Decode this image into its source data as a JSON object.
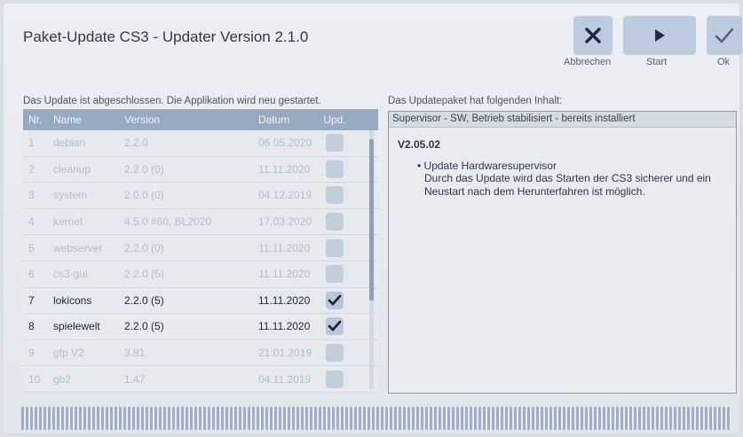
{
  "window": {
    "title": "Paket-Update CS3 - Updater Version 2.1.0"
  },
  "toolbar": {
    "cancel_label": "Abbrechen",
    "start_label": "Start",
    "ok_label": "Ok"
  },
  "status_text": "Das Update ist abgeschlossen. Die Applikation wird neu gestartet.",
  "panel_caption": "Das Updatepaket hat folgenden Inhalt:",
  "table": {
    "headers": {
      "nr": "Nr.",
      "name": "Name",
      "version": "Version",
      "date": "Datum",
      "upd": "Upd."
    },
    "rows": [
      {
        "nr": "1",
        "name": "debian",
        "version": "2.2.0",
        "date": "06.05.2020",
        "checked": false,
        "active": false
      },
      {
        "nr": "2",
        "name": "cleanup",
        "version": "2.2.0 (0)",
        "date": "11.11.2020",
        "checked": false,
        "active": false
      },
      {
        "nr": "3",
        "name": "system",
        "version": "2.0.0 (0)",
        "date": "04.12.2019",
        "checked": false,
        "active": false
      },
      {
        "nr": "4",
        "name": "kernel",
        "version": "4.5.0 #60, BL2020",
        "date": "17.03.2020",
        "checked": false,
        "active": false
      },
      {
        "nr": "5",
        "name": "webserver",
        "version": "2.2.0 (0)",
        "date": "11.11.2020",
        "checked": false,
        "active": false
      },
      {
        "nr": "6",
        "name": "cs3-gui",
        "version": "2.2.0 (5)",
        "date": "11.11.2020",
        "checked": false,
        "active": false
      },
      {
        "nr": "7",
        "name": "lokicons",
        "version": "2.2.0 (5)",
        "date": "11.11.2020",
        "checked": true,
        "active": true
      },
      {
        "nr": "8",
        "name": "spielewelt",
        "version": "2.2.0 (5)",
        "date": "11.11.2020",
        "checked": true,
        "active": true
      },
      {
        "nr": "9",
        "name": "gfp V2",
        "version": "3.81",
        "date": "21.01.2019",
        "checked": false,
        "active": false
      },
      {
        "nr": "10",
        "name": "gb2",
        "version": "1.47",
        "date": "04.11.2019",
        "checked": false,
        "active": false
      }
    ]
  },
  "content_panel": {
    "header": "Supervisor - SW, Betrieb stabilisiert - bereits installiert",
    "version": "V2.05.02",
    "bullet": "Update Hardwaresupervisor",
    "description": "Durch das Update wird das Starten der CS3 sicherer und ein Neustart nach dem Herunterfahren ist möglich."
  },
  "progress": {
    "value": 1.0
  },
  "colors": {
    "header_bg": "#97aac0",
    "button_bg": "#bccbdd",
    "active_text": "#1d2733",
    "inactive_text": "#b4bec9"
  },
  "icons": {
    "cancel": "close-icon",
    "start": "play-icon",
    "ok": "checkmark-icon",
    "check": "checkmark-icon"
  }
}
